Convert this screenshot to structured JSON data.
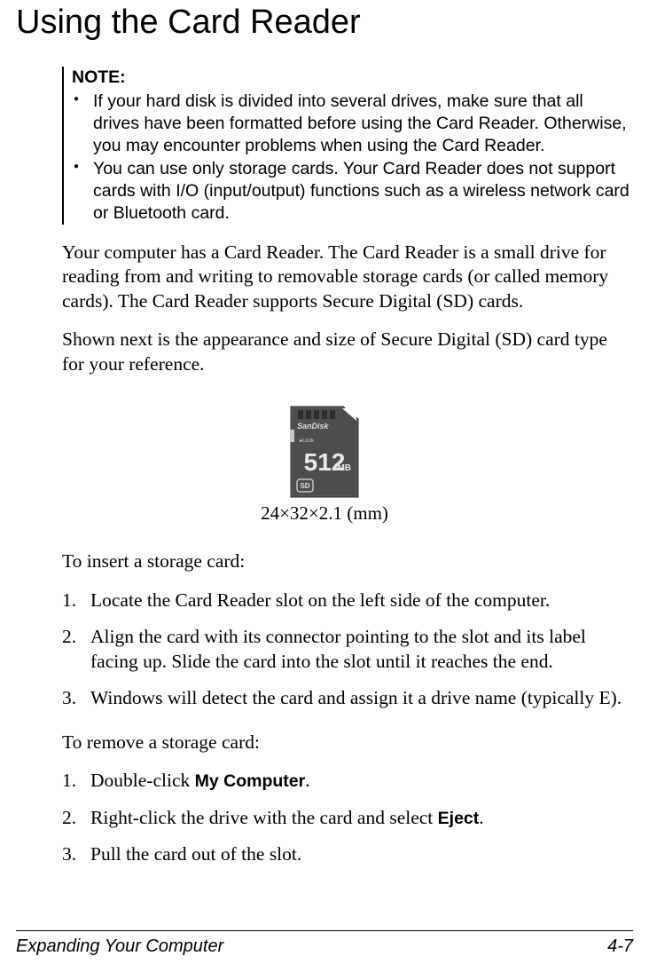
{
  "heading": "Using the Card Reader",
  "note": {
    "label": "NOTE:",
    "items": [
      "If your hard disk is divided into several drives, make sure that all drives have been formatted before using the Card Reader. Otherwise, you may encounter problems when using the Card Reader.",
      "You can use only storage cards. Your Card Reader does not support cards with I/O (input/output) functions such as a wireless network card or Bluetooth card."
    ]
  },
  "intro1": "Your computer has a Card Reader. The Card Reader is a small drive for reading from and writing to removable storage cards (or called memory cards). The Card Reader supports Secure Digital (SD) cards.",
  "intro2": "Shown next is the appearance and size of Secure Digital (SD) card type for your reference.",
  "sd": {
    "brand": "SanDisk",
    "lock_label": "Lock",
    "capacity_num": "512",
    "capacity_unit": "MB",
    "logo": "SD",
    "caption": "24×32×2.1 (mm)"
  },
  "insert": {
    "lead": "To insert a storage card:",
    "steps": [
      "Locate the Card Reader slot on the left side of the computer.",
      "Align the card with its connector pointing to the slot and its label facing up. Slide the card into the slot until it reaches the end.",
      "Windows will detect the card and assign it a drive name (typically E)."
    ]
  },
  "remove": {
    "lead": "To remove a storage card:",
    "step1_pre": "Double-click ",
    "step1_bold": "My Computer",
    "step1_post": ".",
    "step2_pre": "Right-click the drive with the card and select ",
    "step2_bold": "Eject",
    "step2_post": ".",
    "step3": "Pull the card out of the slot."
  },
  "footer": {
    "section": "Expanding Your Computer",
    "page": "4-7"
  }
}
